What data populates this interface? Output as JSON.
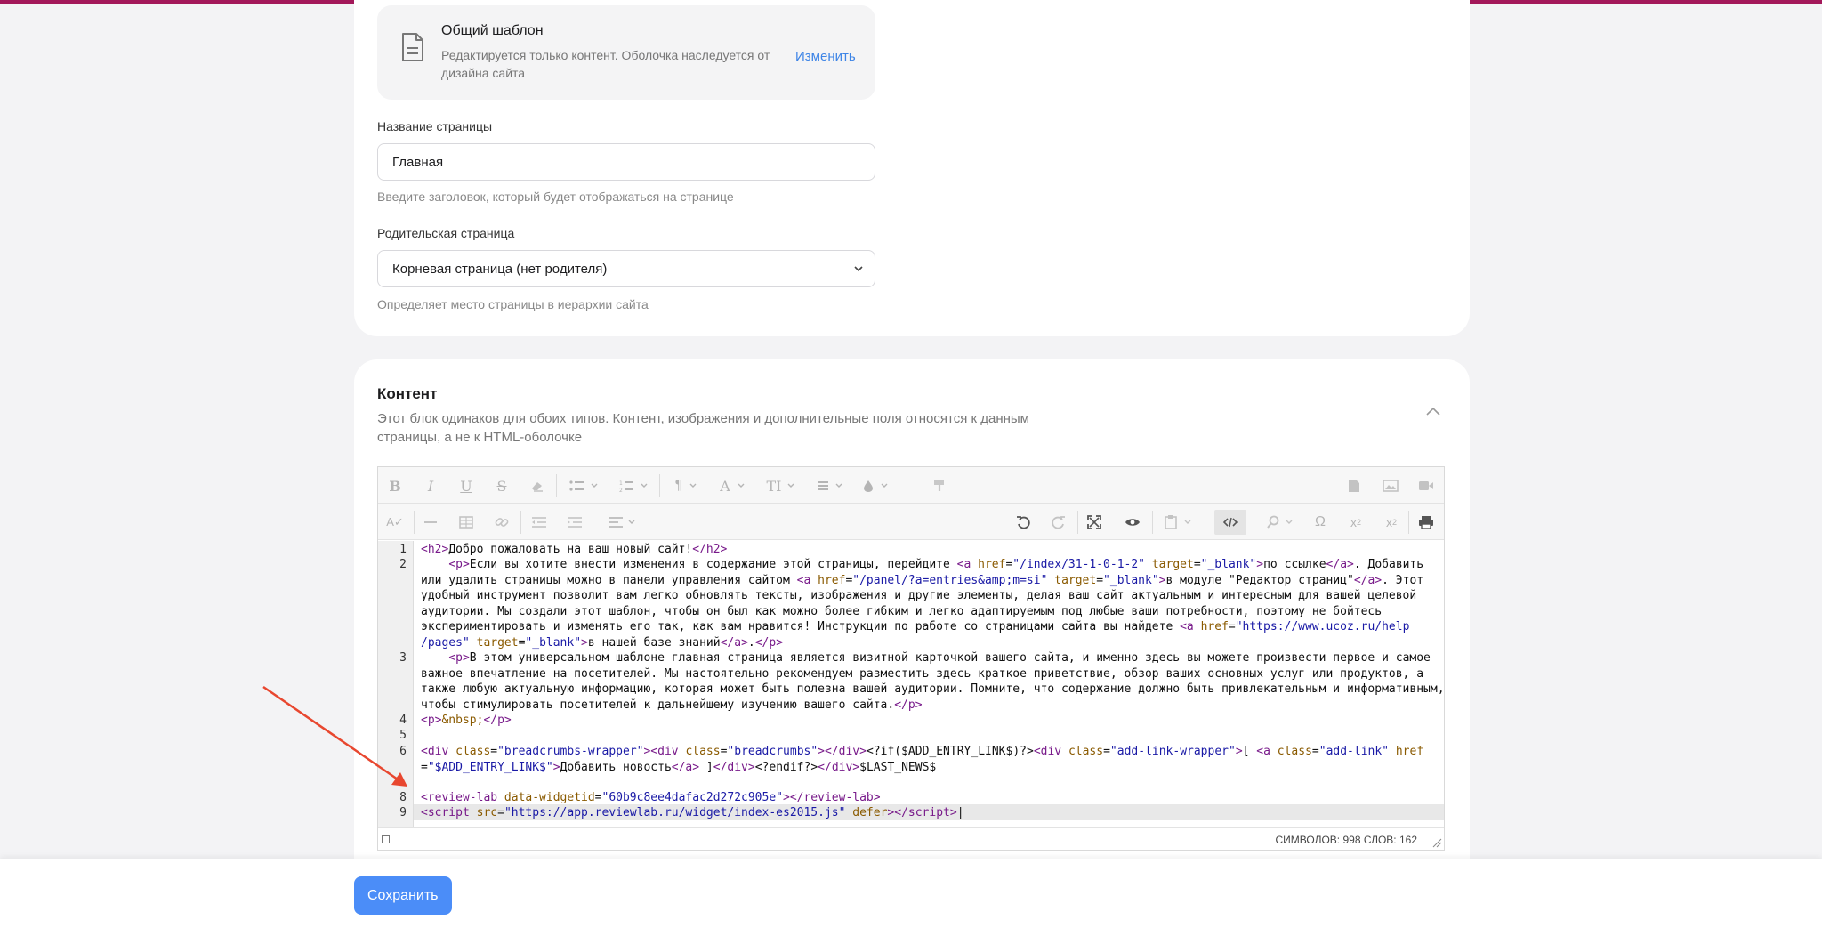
{
  "template": {
    "title": "Общий шаблон",
    "description": "Редактируется только контент. Оболочка наследуется от дизайна сайта",
    "change_link": "Изменить"
  },
  "page_name": {
    "label": "Название страницы",
    "value": "Главная",
    "hint": "Введите заголовок, который будет отображаться на странице"
  },
  "parent_page": {
    "label": "Родительская страница",
    "selected": "Корневая страница (нет родителя)",
    "hint": "Определяет место страницы в иерархии сайта"
  },
  "content": {
    "title": "Контент",
    "description": "Этот блок одинаков для обоих типов. Контент, изображения и дополнительные поля относятся к данным страницы, а не к HTML-оболочке"
  },
  "editor": {
    "line_numbers": [
      "1",
      "2",
      "3",
      "4",
      "5",
      "6",
      "7",
      "8",
      "9"
    ],
    "status": "СИМВОЛОВ: 998   СЛОВ: 162"
  },
  "colors": {
    "accent": "#4b8df8",
    "top_bar": "#a3185a",
    "link": "#3d84e6",
    "annotation_arrow": "#e8472f"
  },
  "footer": {
    "save_label": "Сохранить"
  }
}
